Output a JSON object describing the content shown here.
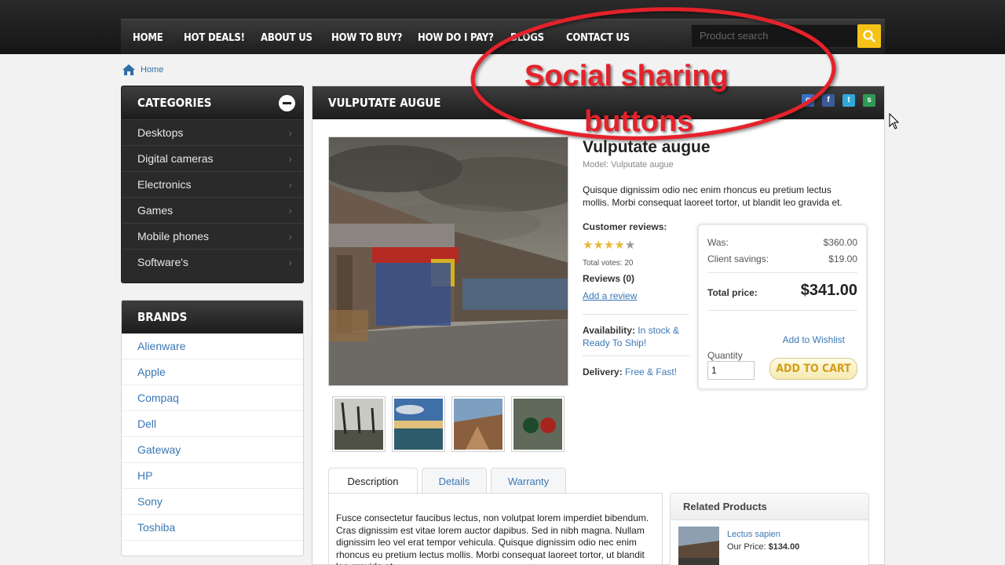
{
  "nav": {
    "items": [
      "HOME",
      "HOT DEALS!",
      "ABOUT US",
      "HOW TO BUY?",
      "HOW DO I PAY?",
      "BLOGS",
      "CONTACT US"
    ],
    "search_placeholder": "Product search"
  },
  "breadcrumb": {
    "home": "Home"
  },
  "categories": {
    "title": "CATEGORIES",
    "items": [
      "Desktops",
      "Digital cameras",
      "Electronics",
      "Games",
      "Mobile phones",
      "Software's"
    ]
  },
  "brands": {
    "title": "BRANDS",
    "items": [
      "Alienware",
      "Apple",
      "Compaq",
      "Dell",
      "Gateway",
      "HP",
      "Sony",
      "Toshiba"
    ]
  },
  "product": {
    "header": "VULPUTATE AUGUE",
    "title": "Vulputate augue",
    "model": "Model: Vulputate augue",
    "description": "Quisque dignissim odio nec enim rhoncus eu pretium lectus mollis. Morbi consequat laoreet tortor, ut blandit leo gravida et.",
    "reviews_label": "Customer reviews:",
    "rating": 4,
    "rating_max": 5,
    "total_votes": "Total votes: 20",
    "reviews_count": "Reviews (0)",
    "add_review": "Add a review",
    "availability_label": "Availability:",
    "availability_value": "In stock & Ready To Ship!",
    "delivery_label": "Delivery:",
    "delivery_value": "Free & Fast!"
  },
  "share": {
    "google": "g",
    "facebook": "f",
    "twitter": "t",
    "share": "s"
  },
  "pricing": {
    "was_label": "Was:",
    "was_value": "$360.00",
    "savings_label": "Client savings:",
    "savings_value": "$19.00",
    "total_label": "Total price:",
    "total_value": "$341.00",
    "wishlist": "Add to Wishlist",
    "quantity_label": "Quantity",
    "quantity_value": "1",
    "add_to_cart": "ADD TO CART"
  },
  "tabs": {
    "items": [
      "Description",
      "Details",
      "Warranty"
    ],
    "description_text": "Fusce consectetur faucibus lectus, non volutpat lorem imperdiet bibendum. Cras dignissim est vitae lorem auctor dapibus. Sed in nibh magna. Nullam dignissim leo vel erat tempor vehicula. Quisque dignissim odio nec enim rhoncus eu pretium lectus mollis. Morbi consequat laoreet tortor, ut blandit leo gravida et."
  },
  "related": {
    "title": "Related Products",
    "item_name": "Lectus sapien",
    "item_price_label": "Our Price:",
    "item_price": "$134.00"
  },
  "annotation": {
    "line1": "Social sharing",
    "line2": "buttons"
  },
  "colors": {
    "accent_yellow": "#f6c218",
    "link_blue": "#3a78b5",
    "annotation_red": "#e4222b",
    "dark_header": "#1c1c1c"
  }
}
